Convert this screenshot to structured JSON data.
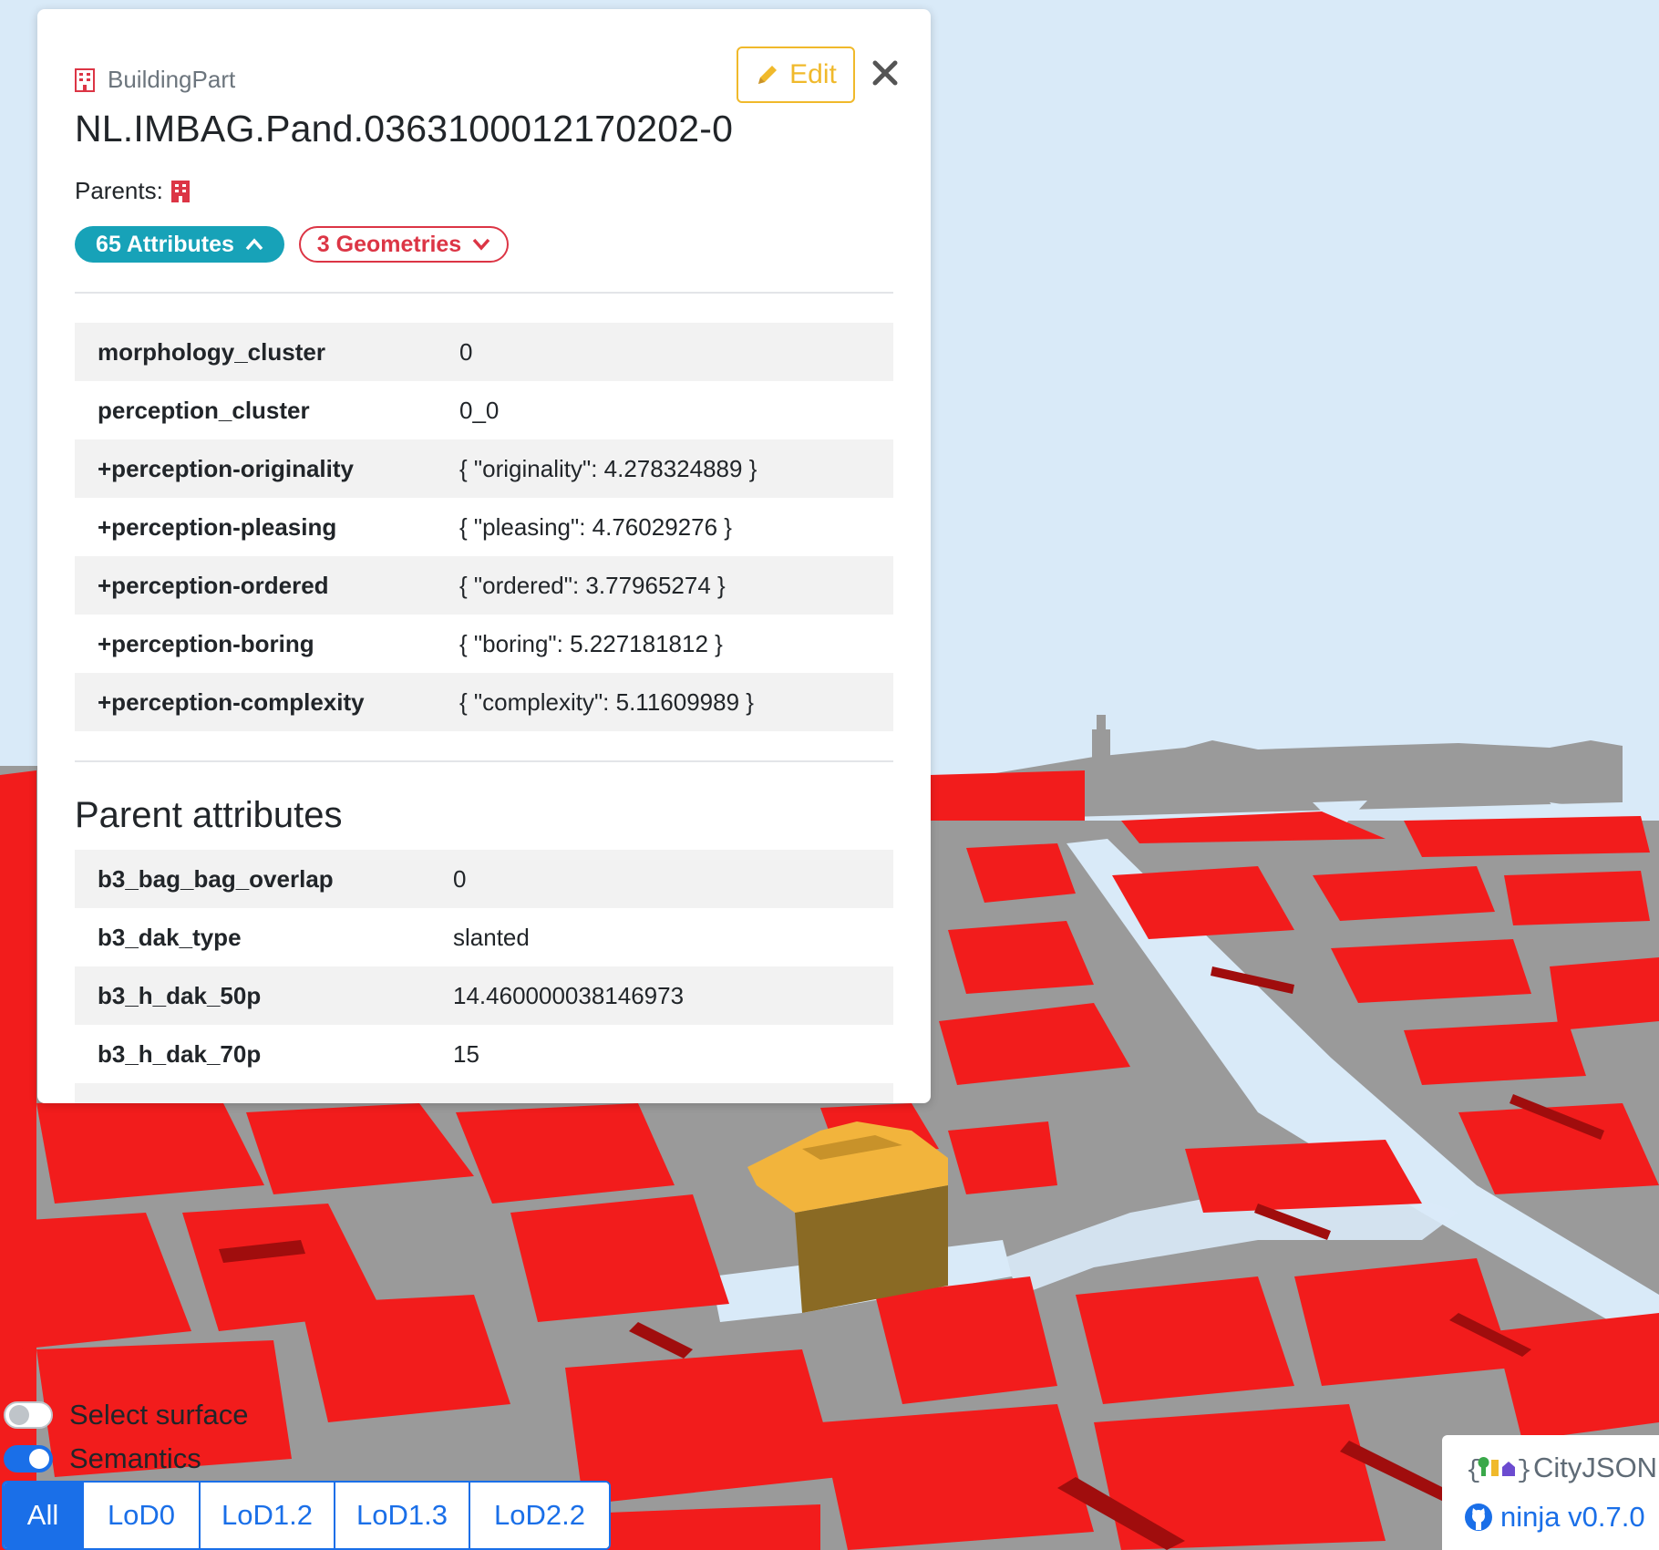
{
  "panel": {
    "object_type": "BuildingPart",
    "object_id": "NL.IMBAG.Pand.0363100012170202-0",
    "edit_label": "Edit",
    "parents_label": "Parents:",
    "attributes_pill": "65 Attributes",
    "geometries_pill": "3 Geometries",
    "attributes": [
      {
        "key": "morphology_cluster",
        "value": "0"
      },
      {
        "key": "perception_cluster",
        "value": "0_0"
      },
      {
        "key": "+perception-originality",
        "value": "{ \"originality\": 4.278324889 }"
      },
      {
        "key": "+perception-pleasing",
        "value": "{ \"pleasing\": 4.76029276 }"
      },
      {
        "key": "+perception-ordered",
        "value": "{ \"ordered\": 3.77965274 }"
      },
      {
        "key": "+perception-boring",
        "value": "{ \"boring\": 5.227181812 }"
      },
      {
        "key": "+perception-complexity",
        "value": "{ \"complexity\": 5.11609989 }"
      }
    ],
    "parent_section_title": "Parent attributes",
    "parent_attributes": [
      {
        "key": "b3_bag_bag_overlap",
        "value": "0"
      },
      {
        "key": "b3_dak_type",
        "value": "slanted"
      },
      {
        "key": "b3_h_dak_50p",
        "value": "14.460000038146973"
      },
      {
        "key": "b3_h_dak_70p",
        "value": "15"
      },
      {
        "key": "",
        "value": ""
      }
    ]
  },
  "controls": {
    "select_surface": {
      "label": "Select surface",
      "checked": false
    },
    "semantics": {
      "label": "Semantics",
      "checked": true
    },
    "lod_buttons": [
      "All",
      "LoD0",
      "LoD1.2",
      "LoD1.3",
      "LoD2.2"
    ],
    "active_lod": "All"
  },
  "branding": {
    "logo_text": "CityJSON",
    "ninja_label": "ninja v0.7.0"
  },
  "colors": {
    "attributes_pill": "#17a2b8",
    "geometries_pill": "#dc3545",
    "edit_button": "#f0b92b",
    "primary": "#1a6fe8",
    "roof_red": "#f21c1c",
    "wall_grey": "#9a9a9a",
    "selected_building": "#f2b43c",
    "sky": "#d9eaf8"
  },
  "icons": {
    "object_type": "building-icon",
    "parent": "building-icon",
    "edit": "pencil-icon",
    "close": "close-icon",
    "attributes_toggle": "chevron-up-icon",
    "geometries_toggle": "chevron-down-icon",
    "ninja": "github-icon"
  }
}
